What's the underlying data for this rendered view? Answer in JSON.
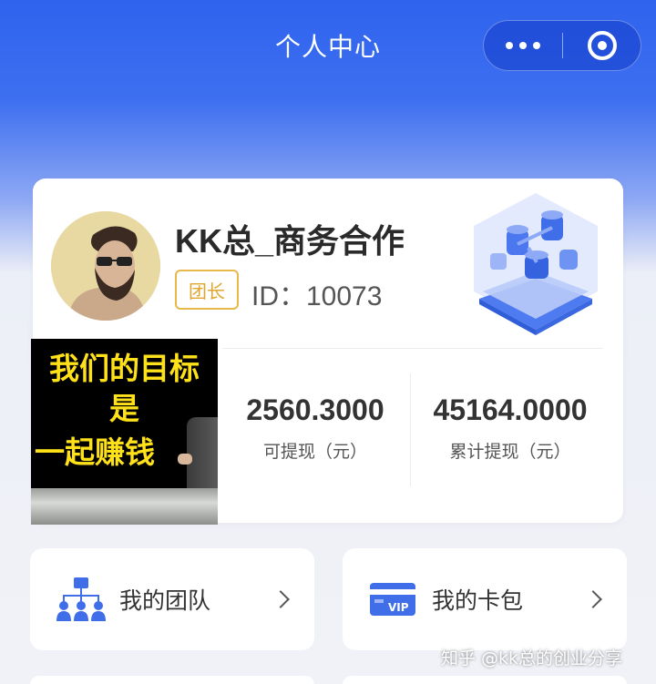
{
  "header": {
    "title": "个人中心"
  },
  "profile": {
    "name": "KK总_商务合作",
    "badge": "团长",
    "id_text": "ID：10073"
  },
  "promo": {
    "lines": [
      "我们的目标",
      "是",
      "一起赚钱"
    ]
  },
  "stats": [
    {
      "value": "2560.3000",
      "label": "可提现（元）"
    },
    {
      "value": "45164.0000",
      "label": "累计提现（元）"
    }
  ],
  "menu": [
    {
      "label": "我的团队",
      "icon": "team-icon"
    },
    {
      "label": "我的卡包",
      "icon": "vip-card-icon",
      "icon_text": "VIP"
    }
  ],
  "watermark": "知乎 @kk总的创业分享",
  "colors": {
    "primary": "#2f63ee",
    "badge": "#e0a530",
    "promo_text": "#ffe11a"
  }
}
